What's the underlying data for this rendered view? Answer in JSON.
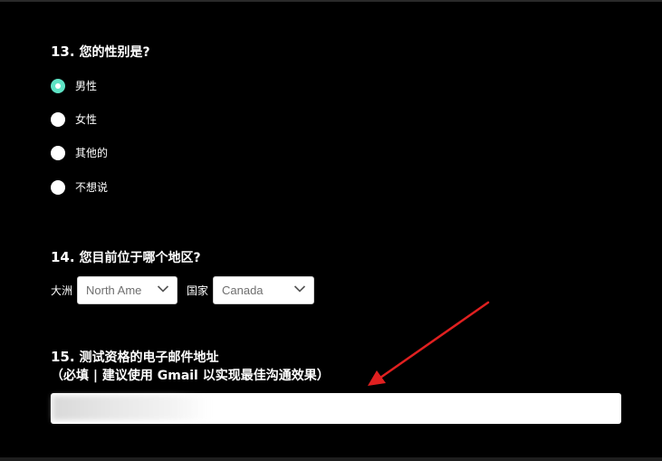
{
  "q13": {
    "number": "13.",
    "title": "您的性别是?",
    "options": [
      "男性",
      "女性",
      "其他的",
      "不想说"
    ],
    "selected": "男性"
  },
  "q14": {
    "number": "14.",
    "title": "您目前位于哪个地区?",
    "continent_label": "大洲",
    "continent_value": "North America",
    "country_label": "国家",
    "country_value": "Canada"
  },
  "q15": {
    "number": "15.",
    "title": "测试资格的电子邮件地址",
    "subtitle": "（必填 | 建议使用 Gmail 以实现最佳沟通效果）",
    "email_value": ""
  },
  "colors": {
    "background": "#000000",
    "radio_selected": "#5ee3c5",
    "annotation_arrow": "#e02020"
  },
  "icons": {
    "dropdown": "chevron-down-icon",
    "annotation": "red-arrow-icon"
  }
}
